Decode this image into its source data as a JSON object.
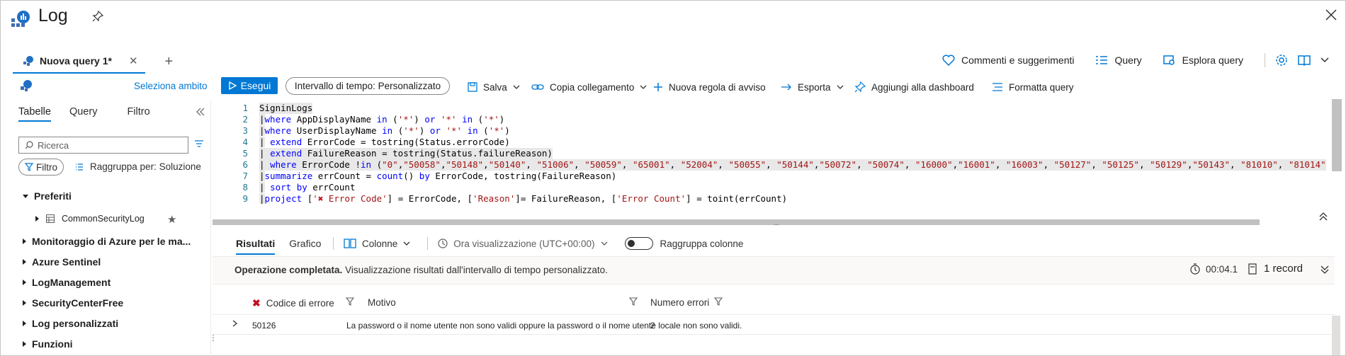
{
  "window": {
    "title": "Log"
  },
  "tabs": {
    "active_label": "Nuova query 1*"
  },
  "top_right": {
    "feedback": "Commenti e suggerimenti",
    "queries": "Query",
    "explore": "Esplora query"
  },
  "toolbar": {
    "select_scope": "Seleziona ambito",
    "run": "Esegui",
    "time_range": "Intervallo di tempo: Personalizzato",
    "save": "Salva",
    "copy_link": "Copia collegamento",
    "new_alert": "Nuova regola di avviso",
    "export": "Esporta",
    "pin": "Aggiungi alla dashboard",
    "format": "Formatta query"
  },
  "sidebar": {
    "tabs": [
      "Tabelle",
      "Query",
      "Filtro"
    ],
    "search_placeholder": "Ricerca",
    "filter_label": "Filtro",
    "group_by": "Raggruppa per: Soluzione",
    "favorites": "Preferiti",
    "favorite_table": "CommonSecurityLog",
    "groups": [
      "Monitoraggio di Azure per le ma...",
      "Azure Sentinel",
      "LogManagement",
      "SecurityCenterFree",
      "Log personalizzati",
      "Funzioni"
    ]
  },
  "editor": {
    "line_numbers": [
      "1",
      "2",
      "3",
      "4",
      "5",
      "6",
      "7",
      "8",
      "9"
    ]
  },
  "results": {
    "tabs": [
      "Risultati",
      "Grafico"
    ],
    "columns_btn": "Colonne",
    "display_time": "Ora visualizzazione (UTC+00:00)",
    "group_columns": "Raggruppa colonne",
    "status_bold": "Operazione completata.",
    "status_text": "Visualizzazione risultati dall'intervallo di tempo personalizzato.",
    "duration": "00:04.1",
    "record_count": "1 record",
    "headers": [
      "Codice di errore",
      "Motivo",
      "Numero errori"
    ],
    "rows": [
      {
        "code": "50126",
        "reason": "La password o il nome utente non sono validi oppure la password o il nome utente locale non sono validi.",
        "count": "2"
      }
    ]
  },
  "colors": {
    "accent": "#0078d4",
    "error_x": "#c50f1f"
  }
}
